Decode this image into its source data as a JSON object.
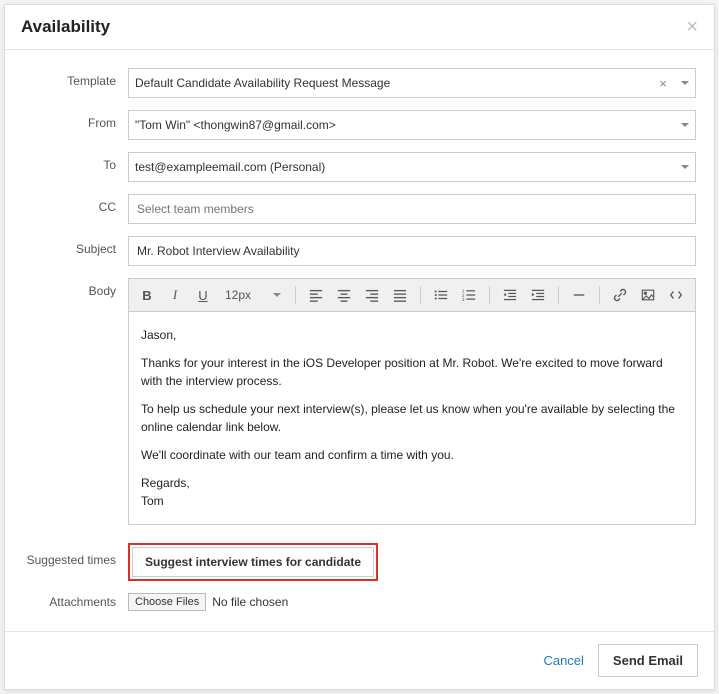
{
  "header": {
    "title": "Availability",
    "close": "×"
  },
  "labels": {
    "template": "Template",
    "from": "From",
    "to": "To",
    "cc": "CC",
    "subject": "Subject",
    "body": "Body",
    "suggested_times": "Suggested times",
    "attachments": "Attachments"
  },
  "fields": {
    "template": "Default Candidate Availability Request Message",
    "from": "\"Tom Win\" <thongwin87@gmail.com>",
    "to": "test@exampleemail.com (Personal)",
    "cc_placeholder": "Select team members",
    "subject": "Mr. Robot Interview Availability",
    "font_size": "12px"
  },
  "body_paragraphs": [
    "Jason,",
    "Thanks for your interest in the iOS Developer position at Mr. Robot. We're excited to move forward with the interview process.",
    "To help us schedule your next interview(s), please let us know when you're available by selecting the online calendar link below.",
    "We'll coordinate with our team and confirm a time with you.",
    "Regards,",
    "Tom"
  ],
  "suggest_button": "Suggest interview times for candidate",
  "attachments": {
    "choose": "Choose Files",
    "none": "No file chosen"
  },
  "footer": {
    "cancel": "Cancel",
    "send": "Send Email"
  }
}
